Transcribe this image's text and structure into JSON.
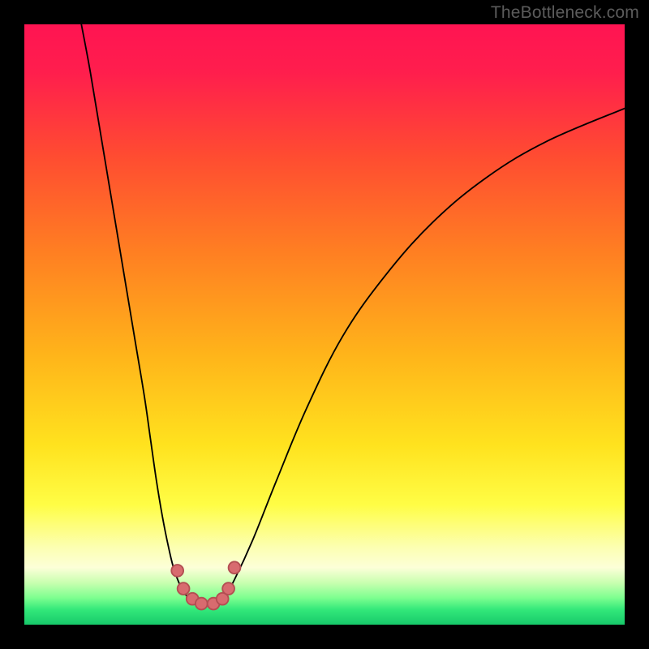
{
  "watermark": "TheBottleneck.com",
  "colors": {
    "black": "#000000",
    "curve": "#000000",
    "marker_fill": "#d86b6f",
    "marker_stroke": "#b34e52",
    "gradient_stops": [
      {
        "offset": 0.0,
        "color": "#ff1452"
      },
      {
        "offset": 0.08,
        "color": "#ff1e4d"
      },
      {
        "offset": 0.22,
        "color": "#ff4c31"
      },
      {
        "offset": 0.38,
        "color": "#ff7f22"
      },
      {
        "offset": 0.55,
        "color": "#ffb41a"
      },
      {
        "offset": 0.7,
        "color": "#ffe21e"
      },
      {
        "offset": 0.8,
        "color": "#fffd45"
      },
      {
        "offset": 0.87,
        "color": "#fcffb0"
      },
      {
        "offset": 0.905,
        "color": "#fcffd8"
      },
      {
        "offset": 0.93,
        "color": "#c9ffb0"
      },
      {
        "offset": 0.955,
        "color": "#7eff90"
      },
      {
        "offset": 0.975,
        "color": "#33e87a"
      },
      {
        "offset": 1.0,
        "color": "#17c96a"
      }
    ]
  },
  "chart_data": {
    "type": "line",
    "title": "",
    "xlabel": "",
    "ylabel": "",
    "xrange": [
      0,
      100
    ],
    "yrange": [
      0,
      100
    ],
    "note": "Axes are unlabeled in the source image; values are read as percentages of the plot area where (0,0) is bottom-left.",
    "series": [
      {
        "name": "left-arm",
        "x": [
          9.5,
          11,
          13,
          15,
          17,
          18.5,
          20,
          21,
          22,
          23,
          24,
          25,
          26.5,
          28
        ],
        "y": [
          100,
          92,
          80,
          68,
          56,
          47,
          38,
          31,
          24,
          18,
          13,
          9,
          5.5,
          4
        ]
      },
      {
        "name": "trough",
        "x": [
          28,
          29,
          30,
          31,
          32,
          33
        ],
        "y": [
          4,
          3.5,
          3.3,
          3.3,
          3.5,
          4
        ]
      },
      {
        "name": "right-arm",
        "x": [
          33,
          35,
          38,
          42,
          47,
          53,
          60,
          68,
          77,
          87,
          100
        ],
        "y": [
          4,
          7.5,
          14,
          24,
          36,
          48,
          58,
          67,
          74.5,
          80.5,
          86
        ]
      }
    ],
    "markers": {
      "name": "dip-markers",
      "shape": "circle",
      "points": [
        {
          "x": 25.5,
          "y": 9.0
        },
        {
          "x": 26.5,
          "y": 6.0
        },
        {
          "x": 28.0,
          "y": 4.3
        },
        {
          "x": 29.5,
          "y": 3.5
        },
        {
          "x": 31.5,
          "y": 3.5
        },
        {
          "x": 33.0,
          "y": 4.3
        },
        {
          "x": 34.0,
          "y": 6.0
        },
        {
          "x": 35.0,
          "y": 9.5
        }
      ]
    }
  }
}
